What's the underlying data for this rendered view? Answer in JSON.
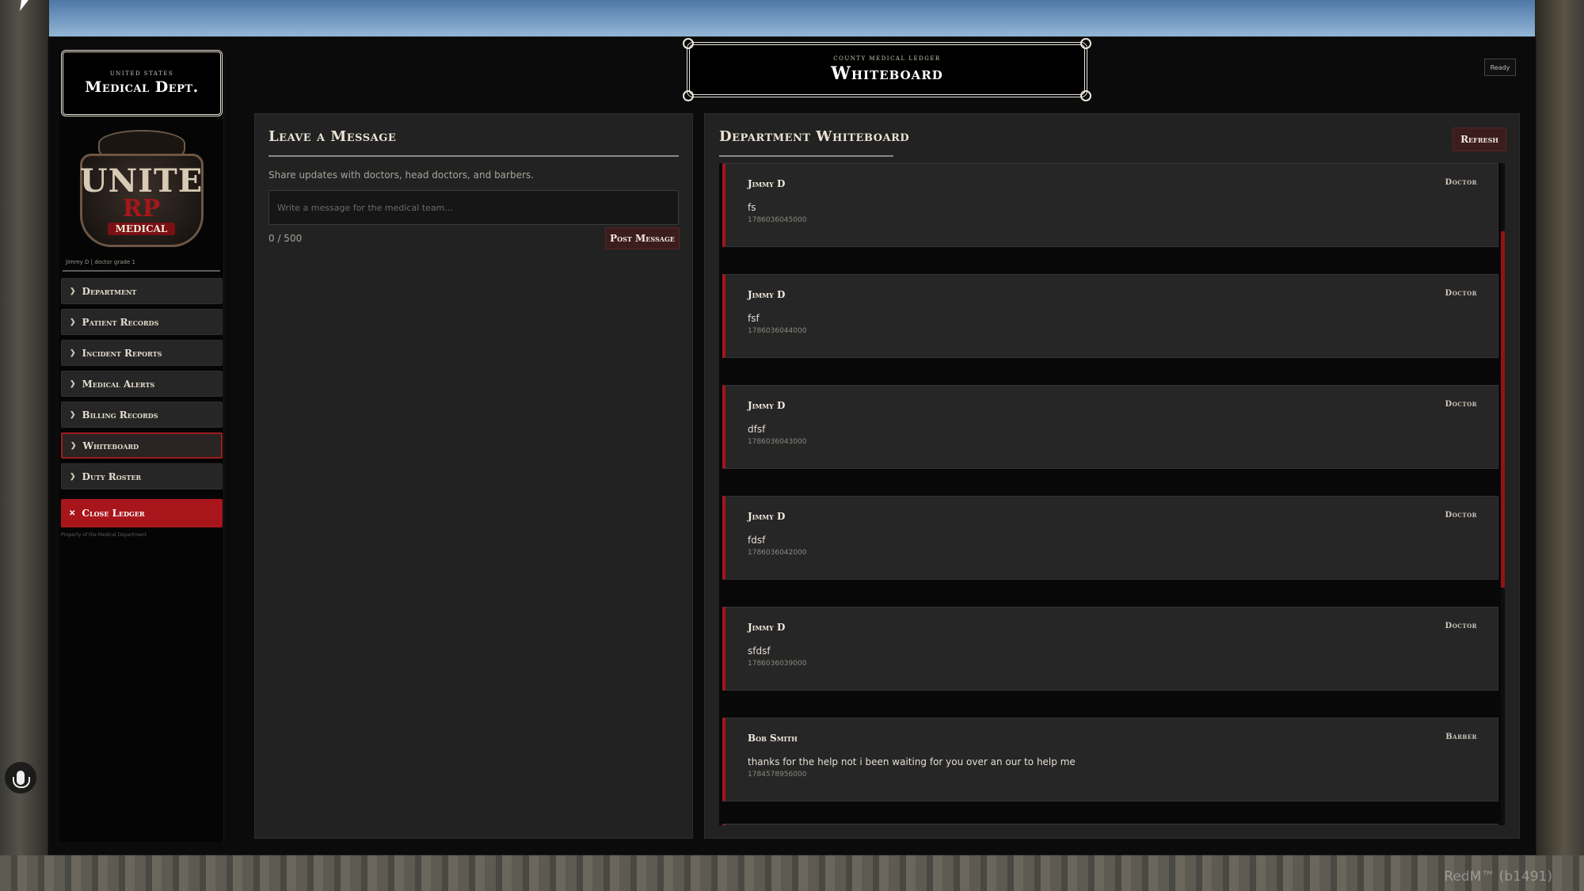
{
  "environment": {
    "watermark": "RedM™ (b1491)"
  },
  "sidebar": {
    "badge_sub": "UNITED STATES",
    "badge_title": "Medical Dept.",
    "logo_line1": "UNITE",
    "logo_line2": "RP",
    "logo_line3": "MEDICAL",
    "user_line": "Jimmy D | doctor grade 1",
    "items": [
      {
        "label": "Department",
        "active": false
      },
      {
        "label": "Patient Records",
        "active": false
      },
      {
        "label": "Incident Reports",
        "active": false
      },
      {
        "label": "Medical Alerts",
        "active": false
      },
      {
        "label": "Billing Records",
        "active": false
      },
      {
        "label": "Whiteboard",
        "active": true
      },
      {
        "label": "Duty Roster",
        "active": false
      }
    ],
    "close_label": "Close Ledger",
    "footnote": "Property of the Medical Department"
  },
  "header": {
    "sub": "COUNTY MEDICAL LEDGER",
    "title": "Whiteboard",
    "status": "Ready"
  },
  "compose": {
    "title": "Leave a Message",
    "description": "Share updates with doctors, head doctors, and barbers.",
    "value": "",
    "placeholder": "Write a message for the medical team...",
    "counter": "0 / 500",
    "post_label": "Post Message"
  },
  "whiteboard": {
    "title": "Department Whiteboard",
    "refresh_label": "Refresh",
    "posts": [
      {
        "author": "Jimmy D",
        "role": "Doctor",
        "text": "fs",
        "timestamp": "1786036045000"
      },
      {
        "author": "Jimmy D",
        "role": "Doctor",
        "text": "fsf",
        "timestamp": "1786036044000"
      },
      {
        "author": "Jimmy D",
        "role": "Doctor",
        "text": "dfsf",
        "timestamp": "1786036043000"
      },
      {
        "author": "Jimmy D",
        "role": "Doctor",
        "text": "fdsf",
        "timestamp": "1786036042000"
      },
      {
        "author": "Jimmy D",
        "role": "Doctor",
        "text": "sfdsf",
        "timestamp": "1786036039000"
      },
      {
        "author": "Bob Smith",
        "role": "Barber",
        "text": "thanks for the help not i been waiting for you over an our to help me",
        "timestamp": "1784578956000"
      }
    ]
  },
  "colors": {
    "accent_red": "#a3161c",
    "button_dark_red": "#3b1d1e",
    "panel_bg": "#222222",
    "app_bg": "#0b0b0b"
  }
}
